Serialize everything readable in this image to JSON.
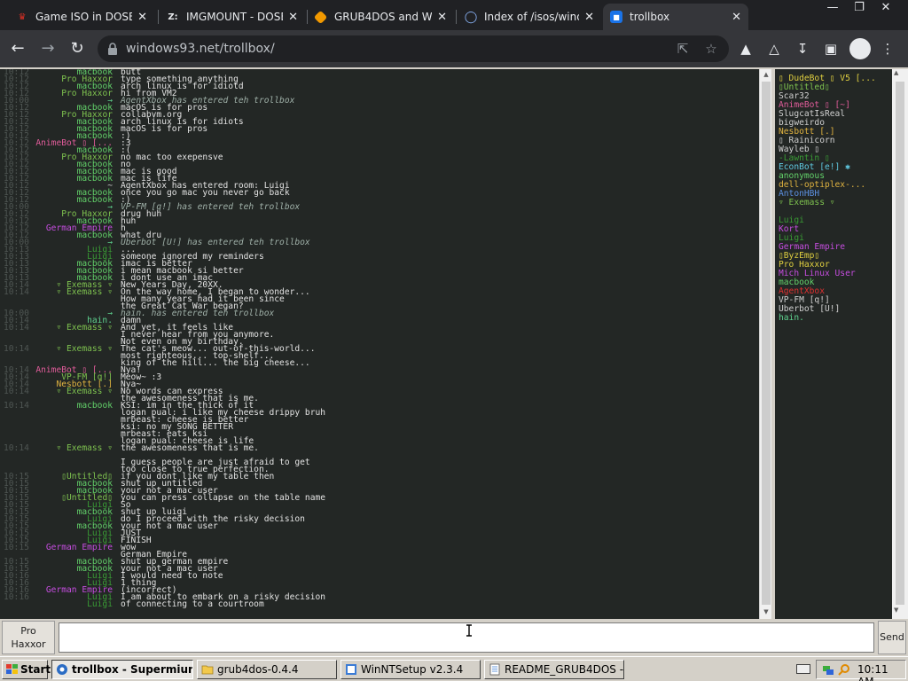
{
  "browser": {
    "tabs": [
      {
        "title": "Game ISO in DOSBo",
        "icon": "joystick-icon",
        "color": "#d93025",
        "active": false
      },
      {
        "title": "IMGMOUNT - DOSBo",
        "icon": "z-logo-icon",
        "color": "#e8eaed",
        "active": false
      },
      {
        "title": "GRUB4DOS and Wi",
        "icon": "diamond-icon",
        "color": "#f29900",
        "active": false
      },
      {
        "title": "Index of /isos/windo",
        "icon": "globe-icon",
        "color": "#8ab4f8",
        "active": false
      },
      {
        "title": "trollbox",
        "icon": "trollbox-icon",
        "color": "#8ab4f8",
        "active": true
      }
    ],
    "url": "windows93.net/trollbox/"
  },
  "chat": {
    "messages": [
      {
        "time": "10:12",
        "nick": "macbook",
        "nick_color": "#63d26a",
        "text": "butt",
        "italic": false
      },
      {
        "time": "10:12",
        "nick": "Pro Haxxor",
        "nick_color": "#7ec24f",
        "text": "type something anything",
        "italic": false
      },
      {
        "time": "10:12",
        "nick": "macbook",
        "nick_color": "#63d26a",
        "text": "arch linux is for idiotd",
        "italic": false
      },
      {
        "time": "10:12",
        "nick": "Pro Haxxor",
        "nick_color": "#7ec24f",
        "text": "hi from VM2",
        "italic": false
      },
      {
        "time": "10:00",
        "nick": "→",
        "nick_color": "#5fd38f",
        "text": "AgentXbox has entered teh trollbox",
        "italic": true
      },
      {
        "time": "10:12",
        "nick": "macbook",
        "nick_color": "#63d26a",
        "text": "macOS is for pros",
        "italic": false
      },
      {
        "time": "10:12",
        "nick": "Pro Haxxor",
        "nick_color": "#7ec24f",
        "text": "collabvm.org",
        "italic": false
      },
      {
        "time": "10:12",
        "nick": "macbook",
        "nick_color": "#63d26a",
        "text": "arch linux is for idiots",
        "italic": false
      },
      {
        "time": "10:12",
        "nick": "macbook",
        "nick_color": "#63d26a",
        "text": "macOS is for pros",
        "italic": false
      },
      {
        "time": "10:12",
        "nick": "macbook",
        "nick_color": "#63d26a",
        "text": ":)",
        "italic": false
      },
      {
        "time": "10:12",
        "nick": "AnimeBot ▯ [...",
        "nick_color": "#e05c9a",
        "text": ":3",
        "italic": false
      },
      {
        "time": "10:12",
        "nick": "macbook",
        "nick_color": "#63d26a",
        "text": ":(",
        "italic": false
      },
      {
        "time": "10:12",
        "nick": "Pro Haxxor",
        "nick_color": "#7ec24f",
        "text": "no mac too exepensve",
        "italic": false
      },
      {
        "time": "10:12",
        "nick": "macbook",
        "nick_color": "#63d26a",
        "text": "no",
        "italic": false
      },
      {
        "time": "10:12",
        "nick": "macbook",
        "nick_color": "#63d26a",
        "text": "mac is good",
        "italic": false
      },
      {
        "time": "10:12",
        "nick": "macbook",
        "nick_color": "#63d26a",
        "text": "mac is life",
        "italic": false
      },
      {
        "time": "10:12",
        "nick": "~",
        "nick_color": "#cfcfcf",
        "text": "AgentXbox has entered room: Luigi",
        "italic": false
      },
      {
        "time": "10:12",
        "nick": "macbook",
        "nick_color": "#63d26a",
        "text": "once you go mac you never go back",
        "italic": false
      },
      {
        "time": "10:12",
        "nick": "macbook",
        "nick_color": "#63d26a",
        "text": ":)",
        "italic": false
      },
      {
        "time": "10:00",
        "nick": "→",
        "nick_color": "#5fd38f",
        "text": "VP-FM [q!] has entered teh trollbox",
        "italic": true
      },
      {
        "time": "10:12",
        "nick": "Pro Haxxor",
        "nick_color": "#7ec24f",
        "text": "drug huh",
        "italic": false
      },
      {
        "time": "10:12",
        "nick": "macbook",
        "nick_color": "#63d26a",
        "text": "huh",
        "italic": false
      },
      {
        "time": "10:12",
        "nick": "German Empire",
        "nick_color": "#c64de0",
        "text": "h",
        "italic": false
      },
      {
        "time": "10:12",
        "nick": "macbook",
        "nick_color": "#63d26a",
        "text": "what dru",
        "italic": false
      },
      {
        "time": "10:00",
        "nick": "→",
        "nick_color": "#5fd38f",
        "text": "Uberbot [U!] has entered teh trollbox",
        "italic": true
      },
      {
        "time": "10:13",
        "nick": "Luigi",
        "nick_color": "#3a9c35",
        "text": "...",
        "italic": false
      },
      {
        "time": "10:13",
        "nick": "Luigi",
        "nick_color": "#3a9c35",
        "text": "someone ignored my reminders",
        "italic": false
      },
      {
        "time": "10:13",
        "nick": "macbook",
        "nick_color": "#63d26a",
        "text": "imac is better",
        "italic": false
      },
      {
        "time": "10:13",
        "nick": "macbook",
        "nick_color": "#63d26a",
        "text": "i mean macbook si better",
        "italic": false
      },
      {
        "time": "10:13",
        "nick": "macbook",
        "nick_color": "#63d26a",
        "text": "i dont use an imac",
        "italic": false
      },
      {
        "time": "10:14",
        "nick": "▿ Exemass ▿",
        "nick_color": "#7ec24f",
        "text": "New Years Day, 20XX.",
        "italic": false
      },
      {
        "time": "10:14",
        "nick": "▿ Exemass ▿",
        "nick_color": "#7ec24f",
        "text": "On the way home, I began to wonder...",
        "italic": false
      },
      {
        "time": "",
        "nick": "",
        "nick_color": "#e3e3e3",
        "text": "How many years had it been since",
        "italic": false
      },
      {
        "time": "",
        "nick": "",
        "nick_color": "#e3e3e3",
        "text": "the Great Cat War began?",
        "italic": false
      },
      {
        "time": "10:00",
        "nick": "→",
        "nick_color": "#5fd38f",
        "text": "hain. has entered teh trollbox",
        "italic": true
      },
      {
        "time": "10:14",
        "nick": "hain.",
        "nick_color": "#5fd38f",
        "text": "damn",
        "italic": false
      },
      {
        "time": "10:14",
        "nick": "▿ Exemass ▿",
        "nick_color": "#7ec24f",
        "text": "And yet, it feels like",
        "italic": false
      },
      {
        "time": "",
        "nick": "",
        "nick_color": "#e3e3e3",
        "text": "I never hear from you anymore.",
        "italic": false
      },
      {
        "time": "",
        "nick": "",
        "nick_color": "#e3e3e3",
        "text": "Not even on my birthday.",
        "italic": false
      },
      {
        "time": "10:14",
        "nick": "▿ Exemass ▿",
        "nick_color": "#7ec24f",
        "text": "The cat's meow... out-of-this-world...",
        "italic": false
      },
      {
        "time": "",
        "nick": "",
        "nick_color": "#e3e3e3",
        "text": "most righteous... top-shelf...",
        "italic": false
      },
      {
        "time": "",
        "nick": "",
        "nick_color": "#e3e3e3",
        "text": "king of the hill... the big cheese...",
        "italic": false
      },
      {
        "time": "10:14",
        "nick": "AnimeBot ▯ [...",
        "nick_color": "#e05c9a",
        "text": "Nya!",
        "italic": false
      },
      {
        "time": "10:14",
        "nick": "VP-FM [q!]",
        "nick_color": "#7ec24f",
        "text": "Meow~ :3",
        "italic": false
      },
      {
        "time": "10:14",
        "nick": "Nesbott [.]",
        "nick_color": "#e0b340",
        "text": "Nya~",
        "italic": false
      },
      {
        "time": "10:14",
        "nick": "▿ Exemass ▿",
        "nick_color": "#7ec24f",
        "text": "No words can express",
        "italic": false
      },
      {
        "time": "",
        "nick": "",
        "nick_color": "#e3e3e3",
        "text": "the awesomeness that is me.",
        "italic": false
      },
      {
        "time": "10:14",
        "nick": "macbook",
        "nick_color": "#63d26a",
        "text": "KSI: im in the thick of it",
        "italic": false
      },
      {
        "time": "",
        "nick": "",
        "nick_color": "#e3e3e3",
        "text": "logan pual: i like my cheese drippy bruh",
        "italic": false
      },
      {
        "time": "",
        "nick": "",
        "nick_color": "#e3e3e3",
        "text": "mrbeast: cheese is better",
        "italic": false
      },
      {
        "time": "",
        "nick": "",
        "nick_color": "#e3e3e3",
        "text": "ksi: no my SONG BETTER",
        "italic": false
      },
      {
        "time": "",
        "nick": "",
        "nick_color": "#e3e3e3",
        "text": "mrbeast: eats ksi",
        "italic": false
      },
      {
        "time": "",
        "nick": "",
        "nick_color": "#e3e3e3",
        "text": "logan pual: cheese is life",
        "italic": false
      },
      {
        "time": "10:14",
        "nick": "▿ Exemass ▿",
        "nick_color": "#7ec24f",
        "text": "the awesomeness that is me.",
        "italic": false
      },
      {
        "time": "",
        "nick": "",
        "nick_color": "#e3e3e3",
        "text": "",
        "italic": false
      },
      {
        "time": "",
        "nick": "",
        "nick_color": "#e3e3e3",
        "text": "I guess people are just afraid to get",
        "italic": false
      },
      {
        "time": "",
        "nick": "",
        "nick_color": "#e3e3e3",
        "text": "too close to true perfection.",
        "italic": false
      },
      {
        "time": "10:15",
        "nick": "▯Untitled▯",
        "nick_color": "#7ec24f",
        "text": "if you dont like my table then",
        "italic": false
      },
      {
        "time": "10:15",
        "nick": "macbook",
        "nick_color": "#63d26a",
        "text": "shut up untitled",
        "italic": false
      },
      {
        "time": "10:15",
        "nick": "macbook",
        "nick_color": "#63d26a",
        "text": "your not a mac user",
        "italic": false
      },
      {
        "time": "10:15",
        "nick": "▯Untitled▯",
        "nick_color": "#7ec24f",
        "text": "you can press collapse on the table name",
        "italic": false
      },
      {
        "time": "10:15",
        "nick": "Luigi",
        "nick_color": "#3a9c35",
        "text": "So",
        "italic": false
      },
      {
        "time": "10:15",
        "nick": "macbook",
        "nick_color": "#63d26a",
        "text": "shut up luigi",
        "italic": false
      },
      {
        "time": "10:15",
        "nick": "Luigi",
        "nick_color": "#3a9c35",
        "text": "do I proceed with the risky decision",
        "italic": false
      },
      {
        "time": "10:15",
        "nick": "macbook",
        "nick_color": "#63d26a",
        "text": "your not a mac user",
        "italic": false
      },
      {
        "time": "10:15",
        "nick": "Luigi",
        "nick_color": "#3a9c35",
        "text": "JUST",
        "italic": false
      },
      {
        "time": "10:15",
        "nick": "Luigi",
        "nick_color": "#3a9c35",
        "text": "FINISH",
        "italic": false
      },
      {
        "time": "10:15",
        "nick": "German Empire",
        "nick_color": "#c64de0",
        "text": "wow",
        "italic": false
      },
      {
        "time": "",
        "nick": "",
        "nick_color": "#e3e3e3",
        "text": "German Empire",
        "italic": false
      },
      {
        "time": "10:15",
        "nick": "macbook",
        "nick_color": "#63d26a",
        "text": "shut up german empire",
        "italic": false
      },
      {
        "time": "10:15",
        "nick": "macbook",
        "nick_color": "#63d26a",
        "text": "your not a mac user",
        "italic": false
      },
      {
        "time": "10:16",
        "nick": "Luigi",
        "nick_color": "#3a9c35",
        "text": "I would need to note",
        "italic": false
      },
      {
        "time": "10:16",
        "nick": "Luigi",
        "nick_color": "#3a9c35",
        "text": "1 thing",
        "italic": false
      },
      {
        "time": "10:16",
        "nick": "German Empire",
        "nick_color": "#c64de0",
        "text": "(incorrect)",
        "italic": false
      },
      {
        "time": "10:16",
        "nick": "Luigi",
        "nick_color": "#3a9c35",
        "text": "I am about to embark on a risky decision",
        "italic": false
      },
      {
        "time": "",
        "nick": "Luigi",
        "nick_color": "#3a9c35",
        "text": "of connecting to a courtroom",
        "italic": false
      }
    ]
  },
  "users": [
    {
      "name": "▯ DudeBot ▯ V5 [...",
      "color": "#e0d040"
    },
    {
      "name": "▯Untitled▯",
      "color": "#7ec24f"
    },
    {
      "name": "Scar32",
      "color": "#d0d0d0"
    },
    {
      "name": "AnimeBot ▯ [~]",
      "color": "#e05c9a"
    },
    {
      "name": "SlugcatIsReal",
      "color": "#d0d0d0"
    },
    {
      "name": "bigweirdo",
      "color": "#d0d0d0"
    },
    {
      "name": "Nesbott [.]",
      "color": "#e0b340"
    },
    {
      "name": "▯ Rainicorn",
      "color": "#d0d0d0"
    },
    {
      "name": "Wayleb ▯",
      "color": "#d0d0d0"
    },
    {
      "name": "-Lawntin ▯",
      "color": "#3a9c35"
    },
    {
      "name": "EconBot [e!] ✱",
      "color": "#5fc8e0"
    },
    {
      "name": "anonymous",
      "color": "#63d26a"
    },
    {
      "name": "dell-optiplex-...",
      "color": "#e0b340"
    },
    {
      "name": "AntonHBH",
      "color": "#5b8fe0"
    },
    {
      "name": "▿ Exemass ▿",
      "color": "#7ec24f"
    },
    {
      "name": "",
      "color": "#d0d0d0"
    },
    {
      "name": "Luigi",
      "color": "#3a9c35"
    },
    {
      "name": "Kort",
      "color": "#c64de0"
    },
    {
      "name": "Luigi",
      "color": "#3a9c35"
    },
    {
      "name": "German Empire",
      "color": "#c64de0"
    },
    {
      "name": "▯ByzEmp▯",
      "color": "#e0d040"
    },
    {
      "name": "Pro Haxxor",
      "color": "#e0d040"
    },
    {
      "name": "Mich Linux User",
      "color": "#c64de0"
    },
    {
      "name": "macbook",
      "color": "#63d26a"
    },
    {
      "name": "AgentXbox",
      "color": "#e03030"
    },
    {
      "name": "VP-FM [q!]",
      "color": "#d0d0d0"
    },
    {
      "name": "Uberbot [U!]",
      "color": "#d0d0d0"
    },
    {
      "name": "hain.",
      "color": "#5fd38f"
    }
  ],
  "input": {
    "nick_label": "Pro Haxxor",
    "value": "",
    "send_label": "Send"
  },
  "taskbar": {
    "start_label": "Start",
    "tasks": [
      {
        "label": "trollbox - Supermium",
        "active": true
      },
      {
        "label": "grub4dos-0.4.4",
        "active": false
      },
      {
        "label": "WinNTSetup v2.3.4",
        "active": false
      },
      {
        "label": "README_GRUB4DOS - ...",
        "active": false
      }
    ],
    "clock": "10:11 AM"
  }
}
